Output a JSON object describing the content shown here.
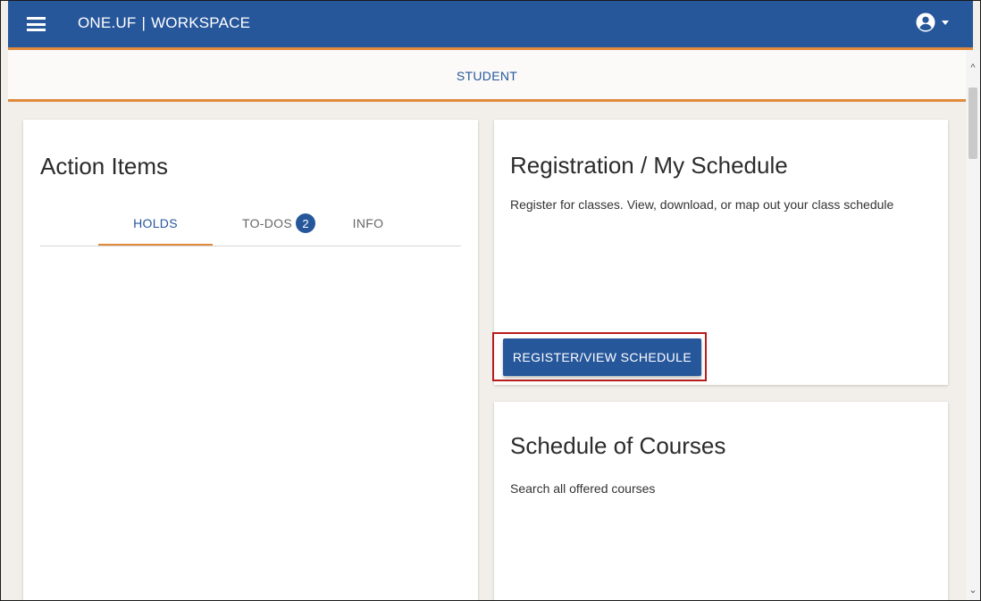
{
  "header": {
    "app_name": "ONE.UF",
    "separator": "|",
    "workspace": "WORKSPACE",
    "menu_icon": "hamburger-menu-icon",
    "account_icon": "user-circle-icon",
    "dropdown_icon": "caret-down-icon"
  },
  "subheader": {
    "label": "STUDENT"
  },
  "action_items": {
    "title": "Action Items",
    "tabs": [
      {
        "label": "HOLDS",
        "active": true
      },
      {
        "label": "TO-DOS",
        "badge": "2",
        "active": false
      },
      {
        "label": "INFO",
        "active": false
      }
    ]
  },
  "registration": {
    "title": "Registration / My Schedule",
    "description": "Register for classes. View, download, or map out your class schedule",
    "button_label": "REGISTER/VIEW SCHEDULE"
  },
  "courses": {
    "title": "Schedule of Courses",
    "description": "Search all offered courses"
  },
  "colors": {
    "primary": "#27579b",
    "accent": "#e08a3c",
    "highlight": "#b71c1c"
  }
}
